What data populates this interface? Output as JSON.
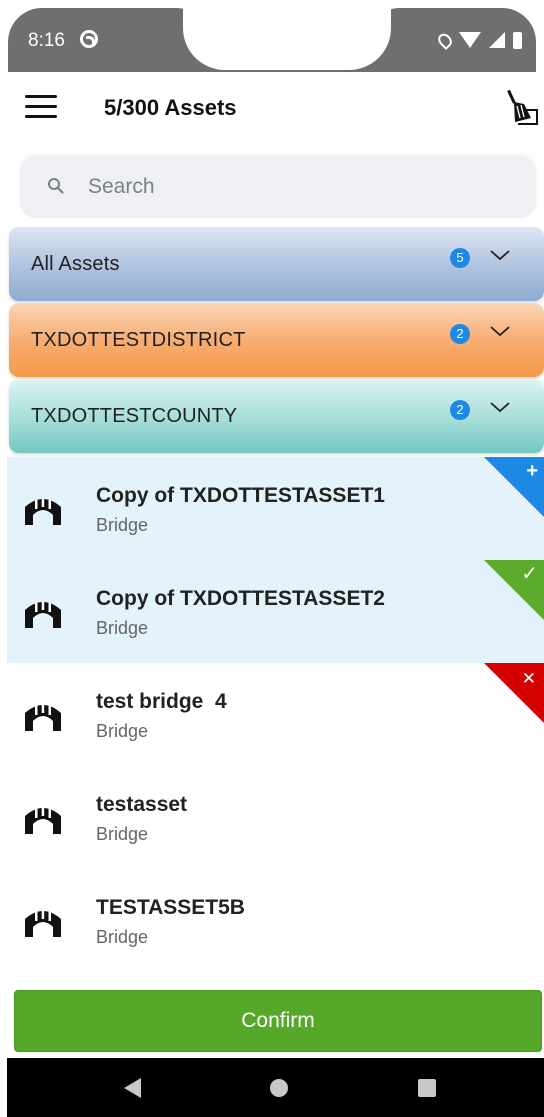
{
  "status_bar": {
    "time": "8:16"
  },
  "header": {
    "title": "5/300 Assets"
  },
  "search": {
    "placeholder": "Search",
    "value": ""
  },
  "groups": [
    {
      "label": "All Assets",
      "count": "5"
    },
    {
      "label": "TXDOTTESTDISTRICT",
      "count": "2"
    },
    {
      "label": "TXDOTTESTCOUNTY",
      "count": "2"
    }
  ],
  "assets": [
    {
      "name": "Copy of TXDOTTESTASSET1",
      "type": "Bridge",
      "selected": true,
      "corner": "add",
      "corner_glyph": "+"
    },
    {
      "name": "Copy of TXDOTTESTASSET2",
      "type": "Bridge",
      "selected": true,
      "corner": "check",
      "corner_glyph": "✓"
    },
    {
      "name": "test bridge  4",
      "type": "Bridge",
      "selected": false,
      "corner": "remove",
      "corner_glyph": "✕"
    },
    {
      "name": "testasset",
      "type": "Bridge",
      "selected": false,
      "corner": "",
      "corner_glyph": ""
    },
    {
      "name": "TESTASSET5B",
      "type": "Bridge",
      "selected": false,
      "corner": "",
      "corner_glyph": ""
    }
  ],
  "confirm_label": "Confirm",
  "colors": {
    "confirm": "#56a829",
    "badge": "#1e88e5",
    "corner_add": "#1e88e5",
    "corner_check": "#5aaa2b",
    "corner_remove": "#d50000",
    "selected_row": "#e3f2fb"
  },
  "icons": {
    "menu": "menu-icon",
    "clear": "broom-icon",
    "search": "search-icon",
    "chevron": "chevron-down-icon",
    "asset": "bridge-icon"
  }
}
